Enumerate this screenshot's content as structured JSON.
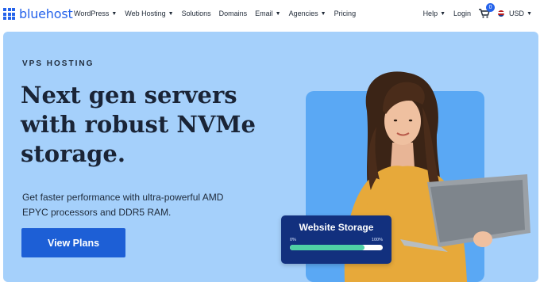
{
  "brand": {
    "name": "bluehost",
    "color": "#2563eb"
  },
  "nav": {
    "items": [
      {
        "label": "WordPress",
        "dropdown": true
      },
      {
        "label": "Web Hosting",
        "dropdown": true
      },
      {
        "label": "Solutions",
        "dropdown": false
      },
      {
        "label": "Domains",
        "dropdown": false
      },
      {
        "label": "Email",
        "dropdown": true
      },
      {
        "label": "Agencies",
        "dropdown": true
      },
      {
        "label": "Pricing",
        "dropdown": false
      }
    ],
    "help_label": "Help",
    "login_label": "Login",
    "cart_count": "0",
    "currency_label": "USD"
  },
  "hero": {
    "eyebrow": "VPS HOSTING",
    "headline_line1": "Next gen servers",
    "headline_line2": "with robust NVMe",
    "headline_line3": "storage.",
    "subtext_line1": "Get faster performance with ultra-powerful AMD",
    "subtext_line2": "EPYC processors and DDR5 RAM.",
    "cta_label": "View Plans",
    "background_color": "#a5d0fb",
    "cta_color": "#1d5fd6"
  },
  "storage_card": {
    "title": "Website Storage",
    "min_label": "0%",
    "max_label": "100%",
    "fill_fraction": 0.8
  }
}
